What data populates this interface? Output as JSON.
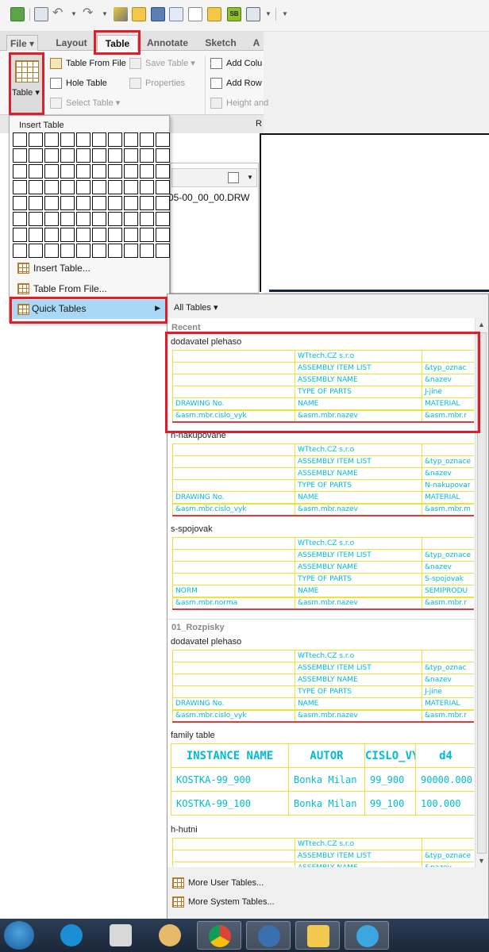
{
  "ribbon_tabs": {
    "file": "File",
    "layout": "Layout",
    "table": "Table",
    "annotate": "Annotate",
    "sketch": "Sketch",
    "more": "A"
  },
  "ribbon": {
    "table_button": "Table",
    "table_from_file": "Table From File",
    "hole_table": "Hole Table",
    "select_table": "Select Table",
    "save_table": "Save Table",
    "properties": "Properties",
    "add_column": "Add Colu",
    "add_row": "Add Row",
    "height_and": "Height and",
    "group_label_r": "R"
  },
  "model_tree": {
    "file_name": "05-00_00_00.DRW"
  },
  "insert_menu": {
    "title": "Insert Table",
    "grid_cols": 10,
    "grid_rows": 8,
    "insert_table": "Insert Table...",
    "table_from_file": "Table From File...",
    "quick_tables": "Quick Tables"
  },
  "quick_tables": {
    "filter": "All Tables",
    "sections": {
      "recent": "Recent",
      "rozpisky": "01_Rozpisky"
    },
    "recent_items": [
      {
        "name": "dodavatel plehaso",
        "rows": [
          [
            "",
            "WTtech.CZ s.r.o",
            ""
          ],
          [
            "",
            "ASSEMBLY ITEM LIST",
            "&typ_oznac"
          ],
          [
            "",
            "ASSEMBLY NAME",
            "&nazev"
          ],
          [
            "",
            "TYPE OF PARTS",
            "J-jine"
          ],
          [
            "DRAWING No.",
            "NAME",
            "MATERIAL"
          ],
          [
            "&asm.mbr.cislo_vyk",
            "&asm.mbr.nazev",
            "&asm.mbr.r"
          ]
        ]
      },
      {
        "name": "n-nakupovane",
        "rows": [
          [
            "",
            "WTtech.CZ s.r.o",
            ""
          ],
          [
            "",
            "ASSEMBLY ITEM LIST",
            "&typ_oznace"
          ],
          [
            "",
            "ASSEMBLY NAME",
            "&nazev"
          ],
          [
            "",
            "TYPE OF PARTS",
            "N-nakupovar"
          ],
          [
            "DRAWING No.",
            "NAME",
            "MATERIAL"
          ],
          [
            "&asm.mbr.cislo_vyk",
            "&asm.mbr.nazev",
            "&asm.mbr.m"
          ]
        ]
      },
      {
        "name": "s-spojovak",
        "rows": [
          [
            "",
            "WTtech.CZ s.r.o",
            ""
          ],
          [
            "",
            "ASSEMBLY ITEM LIST",
            "&typ_oznace"
          ],
          [
            "",
            "ASSEMBLY NAME",
            "&nazev"
          ],
          [
            "",
            "TYPE OF PARTS",
            "S-spojovak"
          ],
          [
            "NORM",
            "NAME",
            "SEMIPRODU"
          ],
          [
            "&asm.mbr.norma",
            "&asm.mbr.nazev",
            "&asm.mbr.r"
          ]
        ]
      }
    ],
    "rozpisky_items": [
      {
        "name": "dodavatel plehaso",
        "rows": [
          [
            "",
            "WTtech.CZ s.r.o",
            ""
          ],
          [
            "",
            "ASSEMBLY ITEM LIST",
            "&typ_oznac"
          ],
          [
            "",
            "ASSEMBLY NAME",
            "&nazev"
          ],
          [
            "",
            "TYPE OF PARTS",
            "J-jine"
          ],
          [
            "DRAWING No.",
            "NAME",
            "MATERIAL"
          ],
          [
            "&asm.mbr.cislo_vyk",
            "&asm.mbr.nazev",
            "&asm.mbr.r"
          ]
        ]
      }
    ],
    "family_table": {
      "name": "family table",
      "header": [
        "INSTANCE NAME",
        "AUTOR",
        "CISLO_VYK",
        "d4"
      ],
      "rows": [
        [
          "KOSTKA-99_900",
          "Bonka Milan",
          "99_900",
          "90000.000"
        ],
        [
          "KOSTKA-99_100",
          "Bonka Milan",
          "99_100",
          "100.000"
        ]
      ]
    },
    "last_item": {
      "name": "h-hutni",
      "rows": [
        [
          "",
          "WTtech.CZ s.r.o",
          ""
        ],
        [
          "",
          "ASSEMBLY ITEM LIST",
          "&typ_oznace"
        ],
        [
          "",
          "ASSEMBLY NAME",
          "&nazev"
        ]
      ]
    },
    "more_user": "More User Tables...",
    "more_system": "More System Tables..."
  },
  "colors": {
    "highlight_red": "#e01e2a",
    "table_line_yellow": "#e9e33a",
    "table_text_cyan": "#00bcd4",
    "quick_tables_selected": "#a8d8f5"
  }
}
